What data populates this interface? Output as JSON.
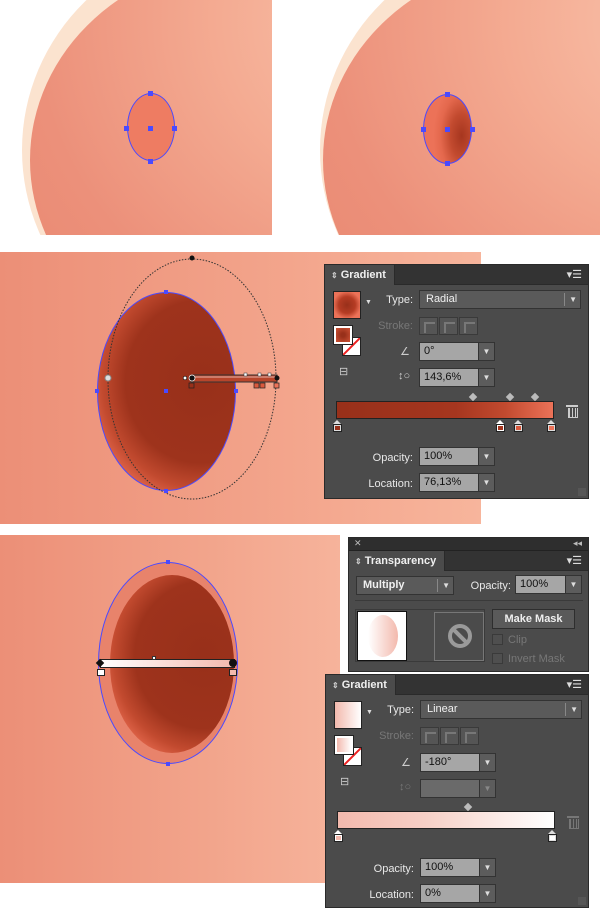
{
  "steps": [
    {
      "id": "step1",
      "description": "Small ellipse selected on cheek"
    },
    {
      "id": "step2",
      "description": "Ellipse with radial gradient applied"
    },
    {
      "id": "step3",
      "description": "Enlarged ellipse with radial gradient annotator"
    },
    {
      "id": "step4",
      "description": "Ellipse overlay with linear gradient annotator"
    }
  ],
  "colors": {
    "skin": "#ef9a80",
    "skin_light": "#f9c3ac",
    "dark_red": "#98301a",
    "mid_red": "#c24a2f",
    "light_coral": "#ec7258",
    "selection_blue": "#4a4aff",
    "pale_pink": "#f3b9ad",
    "panel_bg": "#4b4b4b"
  },
  "gradient_panel_1": {
    "tab_label": "Gradient",
    "type_label": "Type:",
    "type_value": "Radial",
    "stroke_label": "Stroke:",
    "angle_value": "0°",
    "aspect_value": "143,6%",
    "opacity_label": "Opacity:",
    "opacity_value": "100%",
    "location_label": "Location:",
    "location_value": "76,13%",
    "stops": [
      {
        "color": "#98301a",
        "position": 0
      },
      {
        "color": "#a6361f",
        "position": 0.76
      },
      {
        "color": "#d9593d",
        "position": 0.83
      },
      {
        "color": "#ec7258",
        "position": 1.0
      }
    ],
    "midpoints": [
      0.62,
      0.8,
      0.91
    ],
    "selected_stop": 1
  },
  "transparency_panel": {
    "tab_label": "Transparency",
    "blend_mode": "Multiply",
    "opacity_label": "Opacity:",
    "opacity_value": "100%",
    "make_mask_label": "Make Mask",
    "clip_label": "Clip",
    "invert_mask_label": "Invert Mask"
  },
  "gradient_panel_2": {
    "tab_label": "Gradient",
    "type_label": "Type:",
    "type_value": "Linear",
    "stroke_label": "Stroke:",
    "angle_value": "-180°",
    "aspect_value": "",
    "opacity_label": "Opacity:",
    "opacity_value": "100%",
    "location_label": "Location:",
    "location_value": "0%",
    "stops": [
      {
        "color": "#f3b9ad",
        "position": 0
      },
      {
        "color": "#ffffff",
        "position": 1.0
      }
    ],
    "midpoints": [
      0.6
    ],
    "selected_stop": 0
  }
}
